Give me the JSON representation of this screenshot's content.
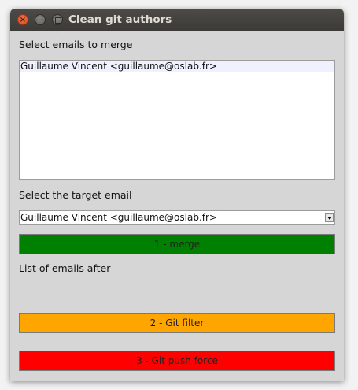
{
  "window": {
    "title": "Clean git authors",
    "controls": {
      "close_glyph": "×",
      "minimize_glyph": "–"
    }
  },
  "sections": {
    "select_emails_label": "Select emails to merge",
    "select_target_label": "Select the target email",
    "list_after_label": "List of emails after"
  },
  "emails_list": {
    "items": [
      {
        "label": "Guillaume Vincent <guillaume@oslab.fr>"
      }
    ]
  },
  "target_select": {
    "selected": "Guillaume Vincent <guillaume@oslab.fr>"
  },
  "buttons": {
    "merge": {
      "label": "1 - merge",
      "color": "#008000"
    },
    "git_filter": {
      "label": "2 - Git filter",
      "color": "#ffa500"
    },
    "git_push_force": {
      "label": "3 - Git push force",
      "color": "#ff0000"
    }
  },
  "icons": {
    "close": "close-icon",
    "minimize": "minimize-icon",
    "maximize": "maximize-icon",
    "dropdown": "chevron-down-icon"
  }
}
